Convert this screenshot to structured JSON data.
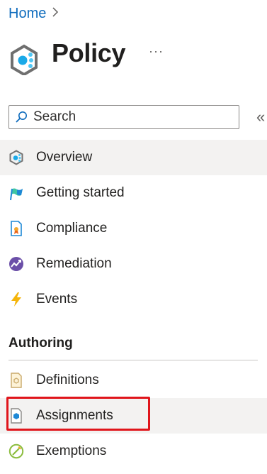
{
  "breadcrumb": {
    "home": "Home"
  },
  "header": {
    "title": "Policy",
    "more": "···"
  },
  "search": {
    "placeholder": "Search",
    "collapse": "«"
  },
  "nav": {
    "items": [
      {
        "label": "Overview",
        "icon": "policy-overview-icon",
        "selected": true
      },
      {
        "label": "Getting started",
        "icon": "getting-started-icon"
      },
      {
        "label": "Compliance",
        "icon": "compliance-icon"
      },
      {
        "label": "Remediation",
        "icon": "remediation-icon"
      },
      {
        "label": "Events",
        "icon": "events-lightning-icon"
      }
    ],
    "authoring": {
      "heading": "Authoring",
      "items": [
        {
          "label": "Definitions",
          "icon": "definitions-icon"
        },
        {
          "label": "Assignments",
          "icon": "assignments-icon",
          "selected": true,
          "highlighted": true
        },
        {
          "label": "Exemptions",
          "icon": "exemptions-icon"
        }
      ]
    }
  },
  "colors": {
    "link": "#0f6cbd",
    "selected_bg": "#f3f2f1",
    "highlight": "#e0151b"
  }
}
